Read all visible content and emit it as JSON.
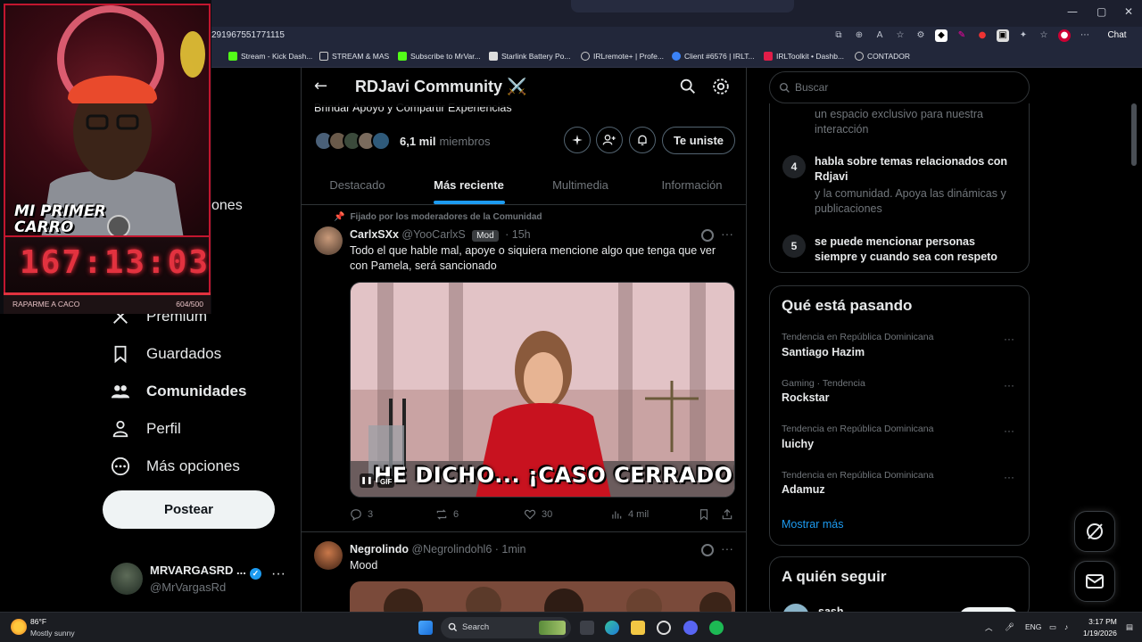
{
  "browser": {
    "url_fragment": "291967551771115",
    "bookmarks": [
      "Stream - Kick Dash...",
      "STREAM & MAS",
      "Subscribe to MrVar...",
      "Starlink Battery Po...",
      "IRLremote+ | Profe...",
      "Client #6576 | IRLT...",
      "IRLToolkit • Dashb...",
      "CONTADOR"
    ],
    "chat_label": "Chat"
  },
  "nav": {
    "partial_label_1": "ones",
    "partial_label_2": "Premium",
    "items": [
      {
        "label": "Guardados",
        "icon": "bookmark-icon"
      },
      {
        "label": "Comunidades",
        "icon": "communities-icon"
      },
      {
        "label": "Perfil",
        "icon": "profile-icon"
      },
      {
        "label": "Más opciones",
        "icon": "more-options-icon"
      }
    ],
    "post_button": "Postear",
    "account": {
      "name": "MRVARGASRD ...",
      "handle": "@MrVargasRd"
    }
  },
  "community": {
    "title": "RDJavi Community ⚔️",
    "subtitle": "Brindar Apoyo y Compartir Experiencias",
    "member_count": "6,1 mil",
    "member_label": "miembros",
    "joined_button": "Te uniste",
    "tabs": [
      "Destacado",
      "Más reciente",
      "Multimedia",
      "Información"
    ],
    "active_tab": "Más reciente"
  },
  "posts": [
    {
      "pinned_label": "Fijado por los moderadores de la Comunidad",
      "name": "CarlxSXx",
      "handle": "@YooCarlxS",
      "badge": "Mod",
      "time": "· 15h",
      "text": "Todo el que hable mal, apoye o siquiera mencione algo que tenga que ver con Pamela, será sancionado",
      "media_caption": "HE DICHO... ¡CASO CERRADO!",
      "gif_badge": "GIF",
      "replies": "3",
      "reposts": "6",
      "likes": "30",
      "views": "4 mil"
    },
    {
      "name": "Negrolindo",
      "handle": "@Negrolindohl6",
      "time": "· 1min",
      "text": "Mood"
    }
  ],
  "sidebar": {
    "search_placeholder": "Buscar",
    "rule_3_desc": "un espacio exclusivo para nuestra interacción",
    "rules": [
      {
        "num": "4",
        "title": "habla sobre temas relacionados con Rdjavi",
        "desc": "y la comunidad. Apoya las dinámicas y publicaciones"
      },
      {
        "num": "5",
        "title": "se puede mencionar personas siempre y cuando sea con respeto",
        "desc": ""
      }
    ],
    "trends_heading": "Qué está pasando",
    "trends": [
      {
        "meta": "Tendencia en República Dominicana",
        "name": "Santiago Hazim"
      },
      {
        "meta": "Gaming · Tendencia",
        "name": "Rockstar"
      },
      {
        "meta": "Tendencia en República Dominicana",
        "name": "luichy"
      },
      {
        "meta": "Tendencia en República Dominicana",
        "name": "Adamuz"
      }
    ],
    "show_more": "Mostrar más",
    "follow_heading": "A quién seguir",
    "follow_partial": "sash"
  },
  "overlay": {
    "cam_text_line1": "MI PRIMER",
    "cam_text_line2": "CARRO",
    "timer": "167:13:03",
    "goal_label": "RAPARME A CACO",
    "goal_count": "604/500",
    "goal_fraction": 1.0
  },
  "taskbar": {
    "temp": "86°F",
    "weather": "Mostly sunny",
    "search": "Search",
    "lang": "ENG",
    "time": "3:17 PM",
    "date": "1/19/2026"
  },
  "colors": {
    "accent": "#1d9bf0",
    "background": "#000000",
    "overlay_red": "#e2323f"
  }
}
